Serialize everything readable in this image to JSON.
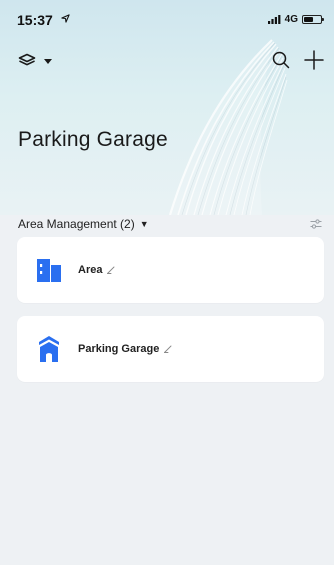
{
  "status_bar": {
    "time": "15:37",
    "network": "4G"
  },
  "header": {
    "title": "Parking Garage"
  },
  "section": {
    "label": "Area Management (2)",
    "caret": "▼"
  },
  "items": [
    {
      "label": "Area",
      "icon": "building-icon"
    },
    {
      "label": "Parking Garage",
      "icon": "garage-icon"
    }
  ],
  "colors": {
    "accent": "#2a6ff0",
    "background": "#eef1f4",
    "hero": "#d6eaf0"
  }
}
